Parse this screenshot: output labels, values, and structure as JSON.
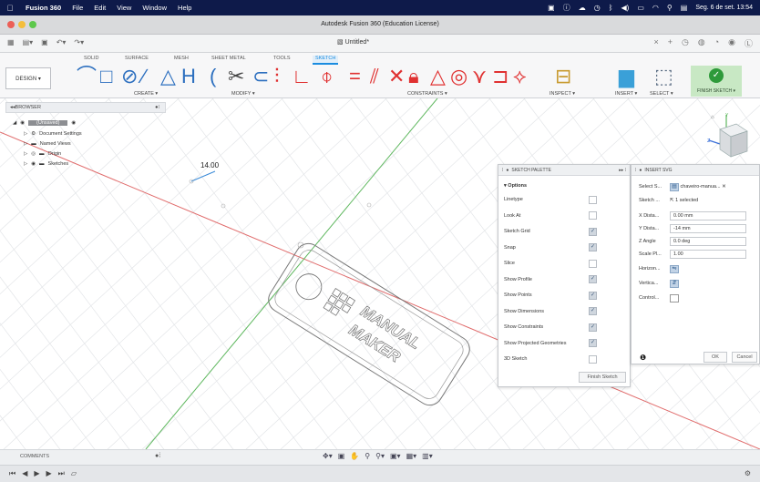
{
  "menubar": {
    "app_name": "Fusion 360",
    "items": [
      "File",
      "Edit",
      "View",
      "Window",
      "Help"
    ],
    "clock": "Seg. 6 de set.  13:54"
  },
  "window": {
    "title": "Autodesk Fusion 360 (Education License)"
  },
  "document": {
    "tab_title": "Untitled*"
  },
  "ribbon": {
    "workspace_tabs": [
      "SOLID",
      "SURFACE",
      "MESH",
      "SHEET METAL",
      "TOOLS",
      "SKETCH"
    ],
    "active_tab": "SKETCH",
    "workspace_button": "DESIGN ▾",
    "groups": {
      "create": "CREATE ▾",
      "modify": "MODIFY ▾",
      "constraints": "CONSTRAINTS ▾",
      "inspect": "INSPECT ▾",
      "insert": "INSERT ▾",
      "select": "SELECT ▾",
      "finish": "FINISH SKETCH ▾"
    }
  },
  "browser": {
    "title": "BROWSER",
    "root": "(Unsaved)",
    "items": [
      "Document Settings",
      "Named Views",
      "Origin",
      "Sketches"
    ]
  },
  "canvas": {
    "dimension_value": "14.00",
    "logo_text_line1": "MANUAL",
    "logo_text_line2": "MAKER"
  },
  "sketch_palette": {
    "title": "SKETCH PALETTE",
    "section": "Options",
    "options": [
      {
        "label": "Linetype",
        "on": false
      },
      {
        "label": "Look At",
        "on": false
      },
      {
        "label": "Sketch Grid",
        "on": true
      },
      {
        "label": "Snap",
        "on": true
      },
      {
        "label": "Slice",
        "on": false
      },
      {
        "label": "Show Profile",
        "on": true
      },
      {
        "label": "Show Points",
        "on": true
      },
      {
        "label": "Show Dimensions",
        "on": true
      },
      {
        "label": "Show Constraints",
        "on": true
      },
      {
        "label": "Show Projected Geometries",
        "on": true
      },
      {
        "label": "3D Sketch",
        "on": false
      }
    ],
    "finish_button": "Finish Sketch"
  },
  "insert_svg": {
    "title": "INSERT SVG",
    "rows": [
      {
        "label": "Select S...",
        "value": "chaveiro-manua..."
      },
      {
        "label": "Sketch ...",
        "value": "1 selected"
      },
      {
        "label": "X Dista...",
        "value": "0.00 mm"
      },
      {
        "label": "Y Dista...",
        "value": "-14 mm"
      },
      {
        "label": "Z Angle",
        "value": "0.0 deg"
      },
      {
        "label": "Scale Pl...",
        "value": "1.00"
      },
      {
        "label": "Horizon...",
        "value": ""
      },
      {
        "label": "Vertica...",
        "value": ""
      },
      {
        "label": "Control...",
        "value": ""
      }
    ],
    "ok_button": "OK",
    "cancel_button": "Cancel"
  },
  "viewcube": {
    "top_label": "TOP",
    "front_label": "FRONT",
    "right_label": "RIGHT"
  },
  "bottom": {
    "comments_label": "COMMENTS"
  },
  "colors": {
    "accent": "#1a8ce0",
    "x_axis": "#e06a6a",
    "y_axis": "#5fb85f",
    "menubar": "#0e1a4a",
    "finish_green": "#2e9a3a"
  }
}
